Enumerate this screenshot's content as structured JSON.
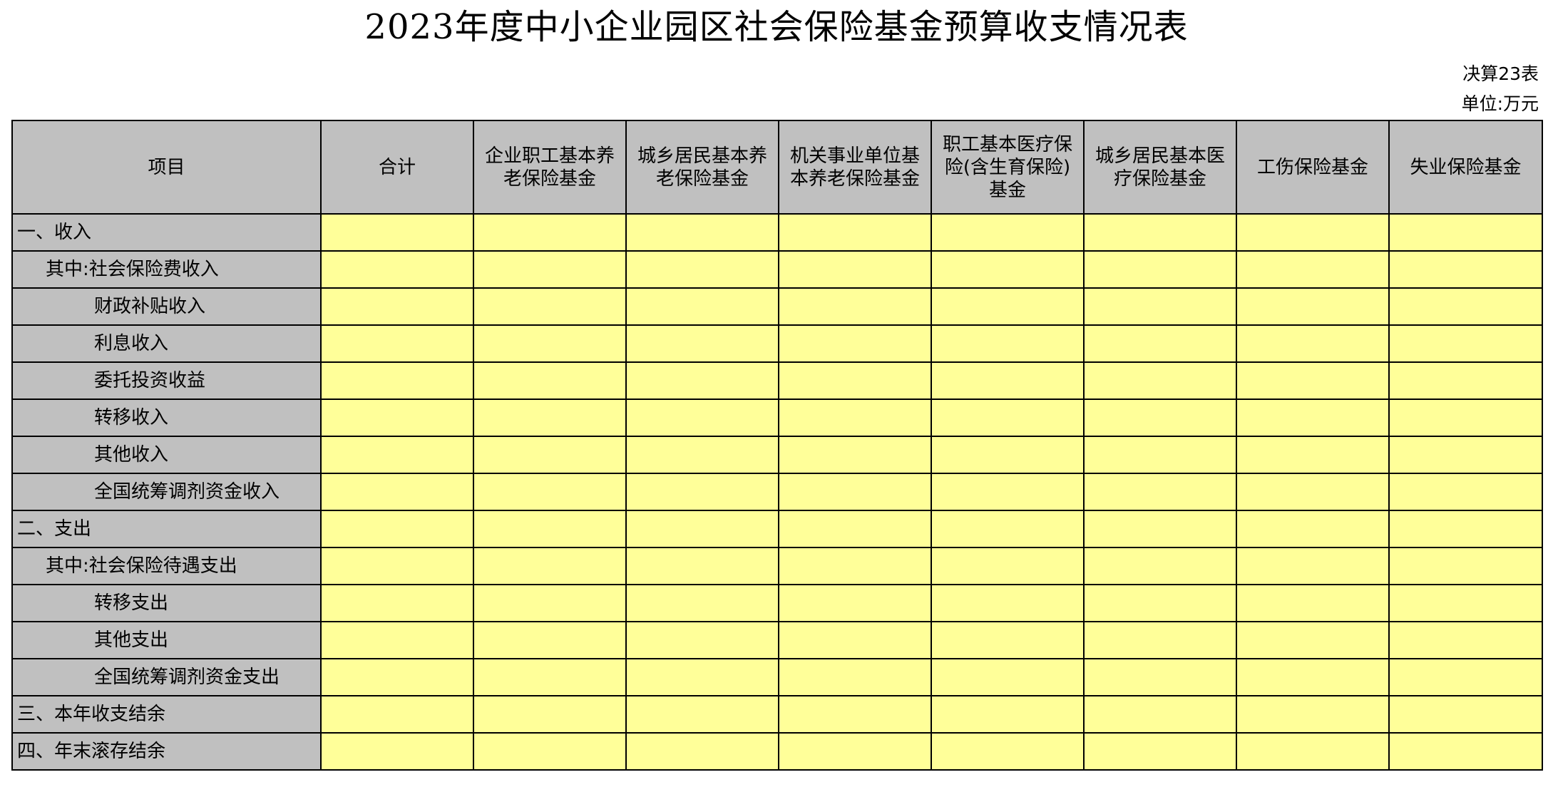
{
  "title": "2023年度中小企业园区社会保险基金预算收支情况表",
  "form_code": "决算23表",
  "unit": "单位:万元",
  "table": {
    "headers": [
      "项目",
      "合计",
      "企业职工基本养老保险基金",
      "城乡居民基本养老保险基金",
      "机关事业单位基本养老保险基金",
      "职工基本医疗保险(含生育保险)基金",
      "城乡居民基本医疗保险基金",
      "工伤保险基金",
      "失业保险基金"
    ],
    "rows": [
      {
        "label": "一、收入",
        "level": 0
      },
      {
        "label": "其中:社会保险费收入",
        "level": 1
      },
      {
        "label": "财政补贴收入",
        "level": 2
      },
      {
        "label": "利息收入",
        "level": 2
      },
      {
        "label": "委托投资收益",
        "level": 2
      },
      {
        "label": "转移收入",
        "level": 2
      },
      {
        "label": "其他收入",
        "level": 2
      },
      {
        "label": "全国统筹调剂资金收入",
        "level": 2
      },
      {
        "label": "二、支出",
        "level": 0
      },
      {
        "label": "其中:社会保险待遇支出",
        "level": 1
      },
      {
        "label": "转移支出",
        "level": 2
      },
      {
        "label": "其他支出",
        "level": 2
      },
      {
        "label": "全国统筹调剂资金支出",
        "level": 2
      },
      {
        "label": "三、本年收支结余",
        "level": 0
      },
      {
        "label": "四、年末滚存结余",
        "level": 0
      }
    ]
  },
  "colors": {
    "header_fill": "#c0c0c0",
    "label_fill": "#c0c0c0",
    "input_fill": "#ffff99",
    "border": "#000000"
  }
}
